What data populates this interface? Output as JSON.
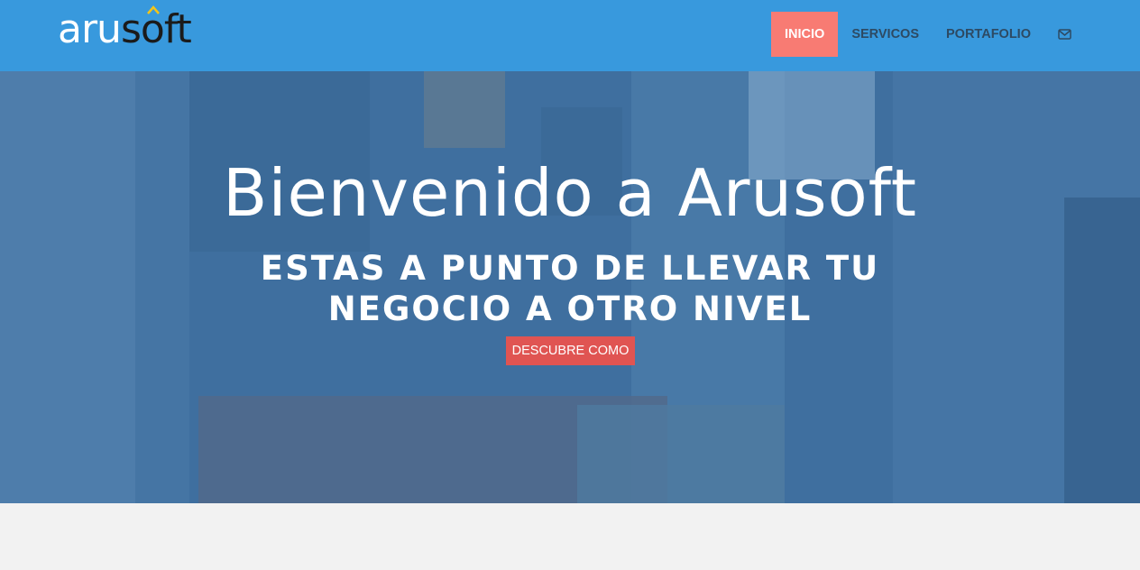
{
  "brand": {
    "logo_part1": "aru",
    "logo_part2": "s",
    "logo_part3": "o",
    "logo_part4": "ft",
    "accent_color": "#f5c518"
  },
  "nav": {
    "items": [
      {
        "label": "INICIO",
        "active": true
      },
      {
        "label": "SERVICOS",
        "active": false
      },
      {
        "label": "PORTAFOLIO",
        "active": false
      }
    ],
    "mail_icon": "envelope-icon",
    "bar_color": "#3899dd",
    "active_color": "#f87b73"
  },
  "hero": {
    "title": "Bienvenido a Arusoft",
    "subtitle": "ESTAS A PUNTO DE LLEVAR TU NEGOCIO A OTRO NIVEL",
    "button_label": "DESCUBRE COMO",
    "button_color": "#e05452"
  }
}
